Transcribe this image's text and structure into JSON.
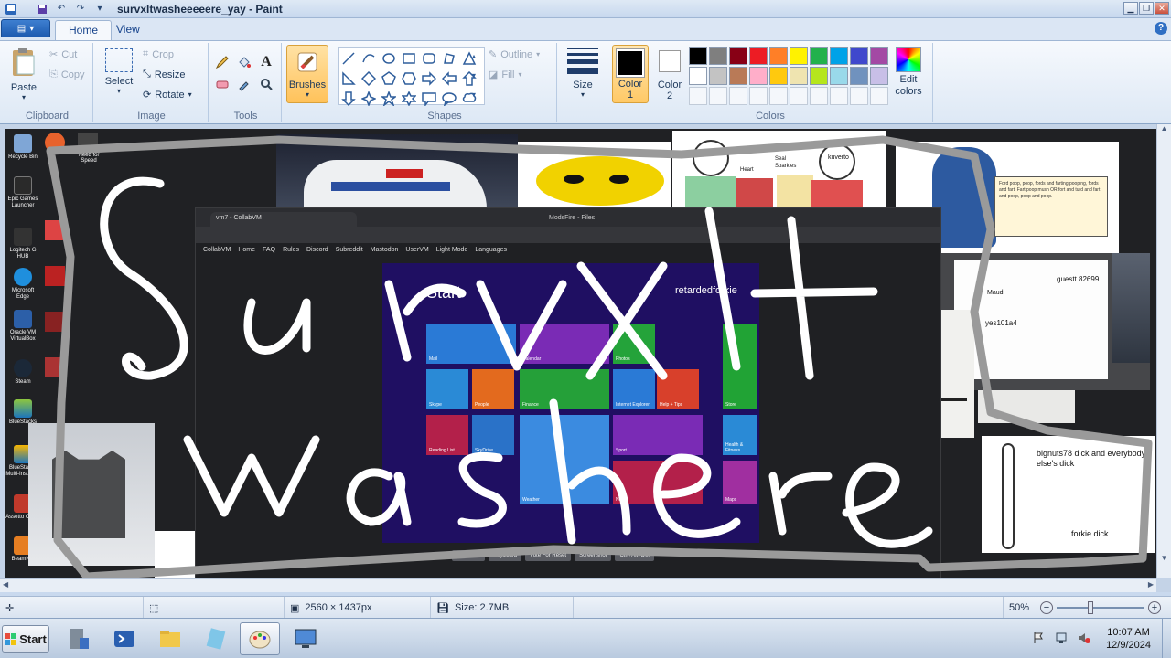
{
  "window": {
    "title": "survxltwasheeeeere_yay - Paint"
  },
  "ribbon": {
    "tabs": [
      {
        "label": "Home",
        "active": true
      },
      {
        "label": "View",
        "active": false
      }
    ],
    "clipboard": {
      "group_label": "Clipboard",
      "paste": "Paste",
      "cut": "Cut",
      "copy": "Copy"
    },
    "image": {
      "group_label": "Image",
      "select": "Select",
      "crop": "Crop",
      "resize": "Resize",
      "rotate": "Rotate"
    },
    "tools": {
      "group_label": "Tools"
    },
    "brushes": {
      "label": "Brushes"
    },
    "shapes": {
      "group_label": "Shapes",
      "outline": "Outline",
      "fill": "Fill"
    },
    "size": {
      "label": "Size"
    },
    "colors": {
      "group_label": "Colors",
      "color1_label": "Color",
      "color1_num": "1",
      "color2_label": "Color",
      "color2_num": "2",
      "edit_colors": "Edit colors",
      "color1": "#000000",
      "color2": "#ffffff",
      "palette_row1": [
        "#000000",
        "#7f7f7f",
        "#880015",
        "#ed1c24",
        "#ff7f27",
        "#fff200",
        "#22b14c",
        "#00a2e8",
        "#3f48cc",
        "#a349a4"
      ],
      "palette_row2": [
        "#ffffff",
        "#c3c3c3",
        "#b97a57",
        "#ffaec9",
        "#ffc90e",
        "#efe4b0",
        "#b5e61d",
        "#99d9ea",
        "#7092be",
        "#c8bfe7"
      ]
    }
  },
  "canvas": {
    "drawn_text_line1": "Survxlt",
    "drawn_text_line2": "was here",
    "desktop_icons": [
      "Recycle Bin",
      "Epic Games Launcher",
      "Logitech G HUB",
      "Microsoft Edge",
      "Oracle VM VirtualBox",
      "Steam",
      "BlueStacks",
      "BlueStacks Multi-Instance",
      "Assetto Corsa",
      "BeamNG"
    ],
    "embedded": {
      "browser_tab1": "vm7 - CollabVM",
      "browser_tab2": "ModsFire - Files",
      "collabvm_nav": [
        "CollabVM",
        "Home",
        "FAQ",
        "Rules",
        "Discord",
        "Subreddit",
        "Mastodon",
        "UserVM",
        "Light Mode",
        "Languages"
      ],
      "start_title": "Start",
      "start_user": "retardedforkie",
      "tiles": [
        "Mail",
        "Calendar",
        "Photos",
        "Skype",
        "People",
        "Finance",
        "Internet Explorer",
        "Help + Tips",
        "Reading List",
        "SkyDrive",
        "Sport",
        "Weather",
        "News",
        "Maps",
        "Store",
        "Health & Fitness"
      ],
      "vm_buttons": [
        "Take Turn",
        "Keyboard",
        "Vote For Reset",
        "Screenshot",
        "Ctrl+Alt+Del"
      ],
      "note_text": "Ford poop, poop, fords and farting pooping, fords and fart. Fart poop mush OR fort and turd and fart and poop, poop and poop.",
      "sketch_labels": [
        "guestt 82699",
        "yes101a4",
        "Maudi",
        "kuverto",
        "Heart",
        "Seal",
        "Sparkles"
      ],
      "doodle_label1": "bignuts78 dick and everybody else's dick",
      "doodle_label2": "forkie dick",
      "need_for_speed": "Need for Speed"
    }
  },
  "status": {
    "dimensions": "2560 × 1437px",
    "size": "Size: 2.7MB",
    "zoom": "50%"
  },
  "taskbar": {
    "start": "Start",
    "time": "10:07 AM",
    "date": "12/9/2024"
  }
}
